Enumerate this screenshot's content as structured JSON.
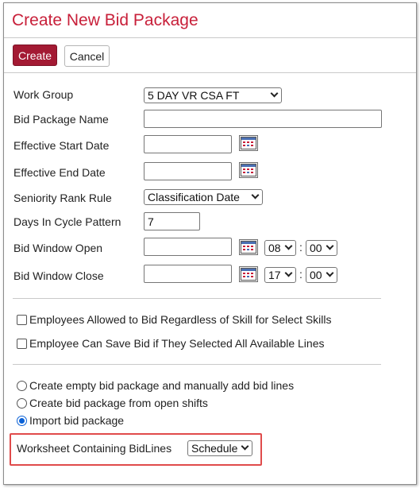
{
  "dialog": {
    "title": "Create New Bid Package"
  },
  "toolbar": {
    "create_label": "Create",
    "cancel_label": "Cancel"
  },
  "form": {
    "work_group": {
      "label": "Work Group",
      "value": "5 DAY VR CSA FT"
    },
    "bid_package_name": {
      "label": "Bid Package Name",
      "value": ""
    },
    "effective_start_date": {
      "label": "Effective Start Date",
      "value": ""
    },
    "effective_end_date": {
      "label": "Effective End Date",
      "value": ""
    },
    "seniority_rank_rule": {
      "label": "Seniority Rank Rule",
      "value": "Classification Date"
    },
    "days_in_cycle_pattern": {
      "label": "Days In Cycle Pattern",
      "value": "7"
    },
    "bid_window_open": {
      "label": "Bid Window Open",
      "date": "",
      "hour": "08",
      "minute": "00"
    },
    "bid_window_close": {
      "label": "Bid Window Close",
      "date": "",
      "hour": "17",
      "minute": "00"
    },
    "time_separator": ":"
  },
  "options": {
    "employees_allowed_regardless": {
      "label": "Employees Allowed to Bid Regardless of Skill for Select Skills",
      "checked": false
    },
    "employee_can_save_bid": {
      "label": "Employee Can Save Bid if They Selected All Available Lines",
      "checked": false
    }
  },
  "creation_mode": {
    "options": [
      {
        "label": "Create empty bid package and manually add bid lines",
        "selected": false
      },
      {
        "label": "Create bid package from open shifts",
        "selected": false
      },
      {
        "label": "Import bid package",
        "selected": true
      }
    ]
  },
  "worksheet": {
    "label": "Worksheet Containing BidLines",
    "value": "Schedule"
  },
  "colors": {
    "title": "#c8203a",
    "primary_button": "#a31a33",
    "highlight_border": "#e04b4b",
    "radio_selected": "#0b61d6"
  },
  "icons": {
    "calendar": "calendar-icon",
    "dropdown": "chevron-down-icon"
  }
}
